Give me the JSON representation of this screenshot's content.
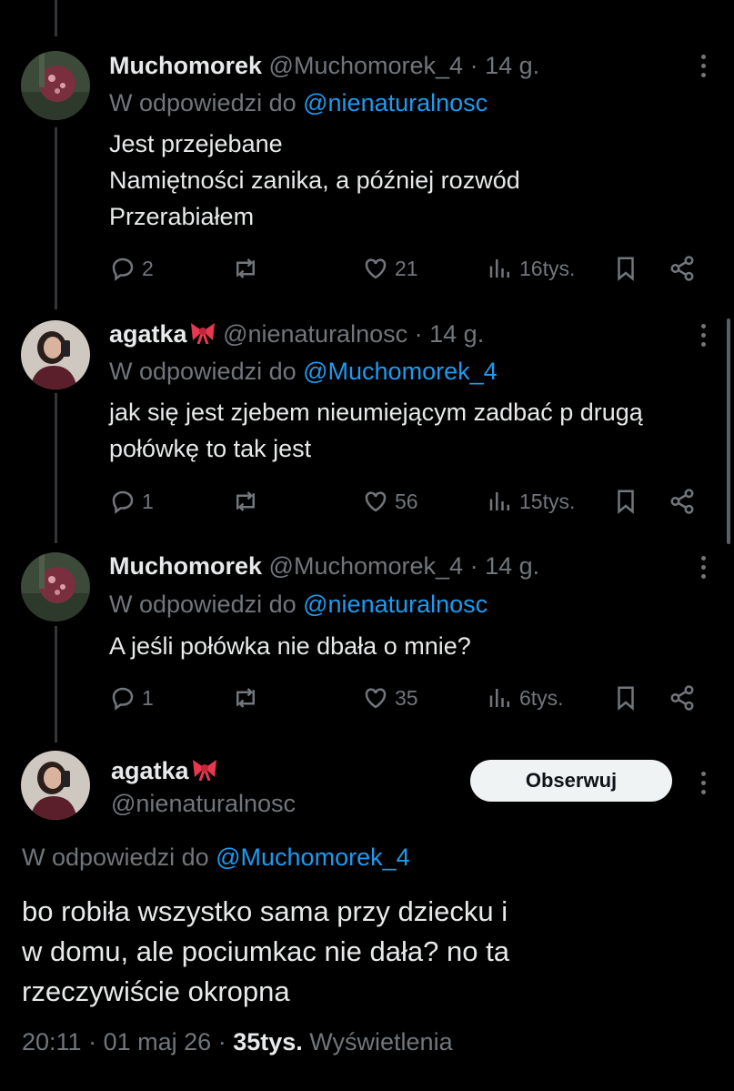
{
  "colors": {
    "background": "#000000",
    "text": "#e7e9ea",
    "muted": "#71767b",
    "link": "#1d9bf0"
  },
  "replies": [
    {
      "name": "Muchomorek",
      "handle": "@Muchomorek_4",
      "sep": "·",
      "time": "14 g.",
      "reply_prefix": "W odpowiedzi do ",
      "reply_to": "@nienaturalnosc",
      "lines": [
        "Jest przejebane",
        "Namiętności zanika, a później rozwód",
        "Przerabiałem"
      ],
      "replies_count": "2",
      "likes": "21",
      "views": "16tys."
    },
    {
      "name": "agatka",
      "handle": "@nienaturalnosc",
      "sep": "·",
      "time": "14 g.",
      "reply_prefix": "W odpowiedzi do ",
      "reply_to": "@Muchomorek_4",
      "lines": [
        "jak się jest zjebem nieumiejącym zadbać p drugą",
        "połówkę to tak jest"
      ],
      "replies_count": "1",
      "likes": "56",
      "views": "15tys."
    },
    {
      "name": "Muchomorek",
      "handle": "@Muchomorek_4",
      "sep": "·",
      "time": "14 g.",
      "reply_prefix": "W odpowiedzi do ",
      "reply_to": "@nienaturalnosc",
      "lines": [
        "A jeśli połówka nie dbała o mnie?"
      ],
      "replies_count": "1",
      "likes": "35",
      "views": "6tys."
    }
  ],
  "main_tweet": {
    "name": "agatka",
    "handle": "@nienaturalnosc",
    "follow_label": "Obserwuj",
    "reply_prefix": "W odpowiedzi do ",
    "reply_to": "@Muchomorek_4",
    "lines": [
      "bo robiła wszystko sama przy dziecku i",
      "w domu, ale pociumkac nie dała? no ta",
      "rzeczywiście okropna"
    ],
    "time": "20:11",
    "date": "01 maj 26",
    "sep": "·",
    "views_count": "35tys.",
    "views_label": "Wyświetlenia"
  },
  "icons": [
    "reply-icon",
    "retweet-icon",
    "like-icon",
    "views-icon",
    "bookmark-icon",
    "share-icon",
    "more-icon",
    "bow-emoji"
  ]
}
